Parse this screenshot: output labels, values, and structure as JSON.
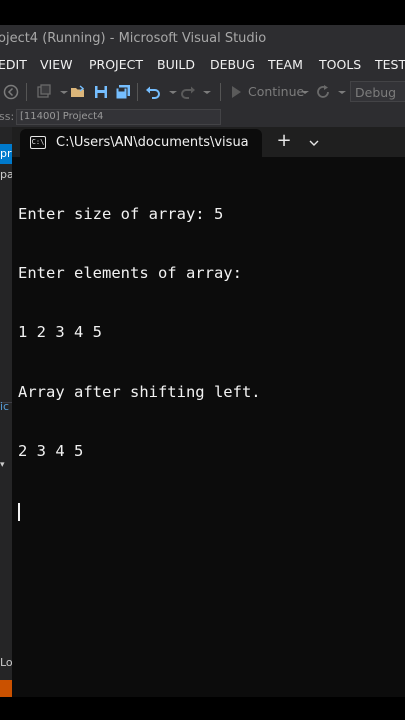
{
  "vs": {
    "title": "oject4 (Running) - Microsoft Visual Studio",
    "menu": [
      "EDIT",
      "VIEW",
      "PROJECT",
      "BUILD",
      "DEBUG",
      "TEAM",
      "TOOLS",
      "TEST"
    ],
    "toolbar": {
      "continue_label": "Continue",
      "config": "Debug"
    },
    "process_label": "ss:",
    "process_value": "[11400] Project4",
    "left_panel_fragments": [
      "pr",
      "pal",
      "ic",
      "Lo"
    ]
  },
  "console": {
    "tab_title": "C:\\Users\\AN\\documents\\visua",
    "tab_icon_text": "C:\\",
    "new_tab_symbol": "+",
    "dropdown_symbol": "⌄",
    "lines": [
      "Enter size of array: 5",
      "Enter elements of array:",
      "1 2 3 4 5",
      "Array after shifting left.",
      "2 3 4 5"
    ]
  },
  "colors": {
    "vs_chrome": "#2d2d30",
    "console_bg": "#0c0c0c",
    "console_text": "#f2f2f2",
    "status_bar": "#ca5100"
  }
}
